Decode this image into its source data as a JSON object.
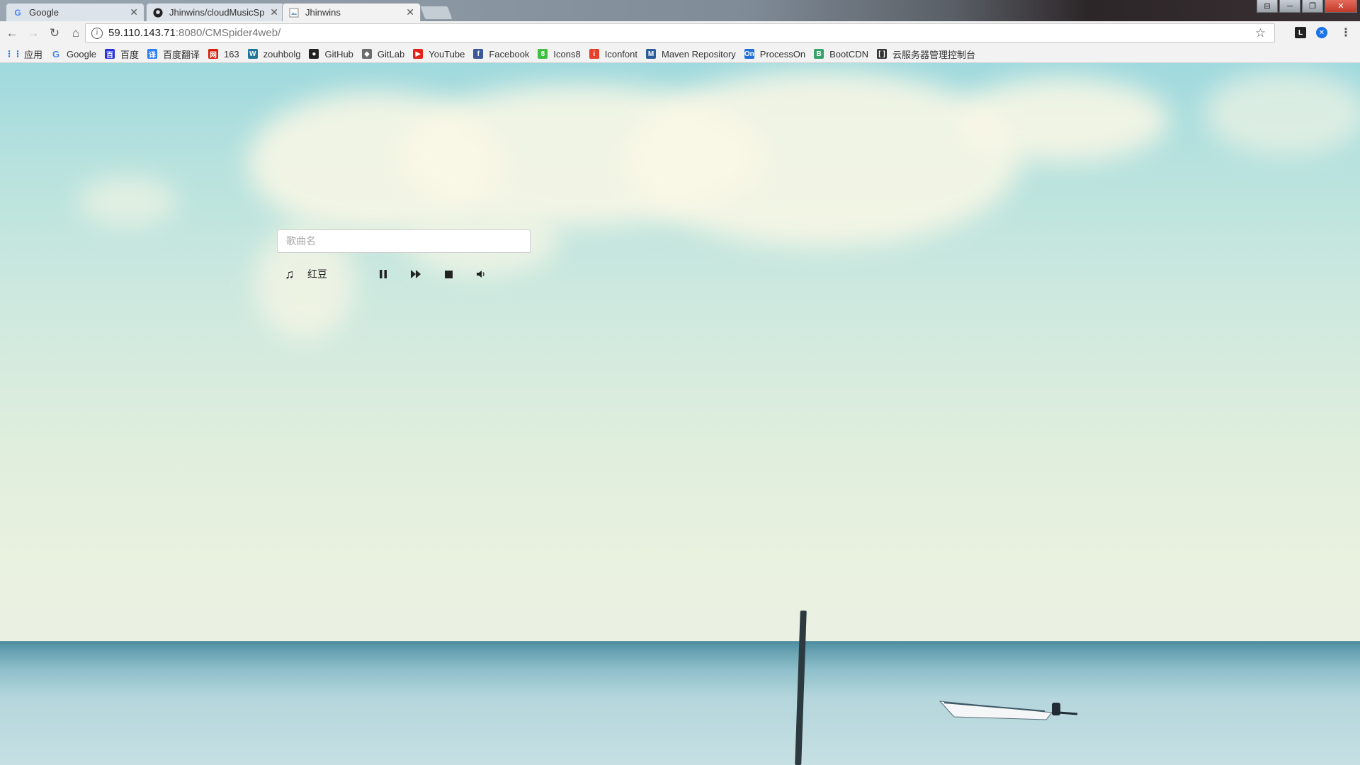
{
  "browser": {
    "tabs": [
      {
        "title": "Google",
        "icon": "google-icon"
      },
      {
        "title": "Jhinwins/cloudMusicSp",
        "icon": "github-icon"
      },
      {
        "title": "Jhinwins",
        "icon": "page-icon"
      }
    ],
    "url_host": "59.110.143.71",
    "url_path": ":8080/CMSpider4web/"
  },
  "bookmarks": [
    {
      "label": "应用",
      "icon": "apps-grid-icon",
      "color": "#1a73e8"
    },
    {
      "label": "Google",
      "icon": "google-icon",
      "color": "#4285f4"
    },
    {
      "label": "百度",
      "icon": "baidu-icon",
      "color": "#2932e1"
    },
    {
      "label": "百度翻译",
      "icon": "baidu-translate-icon",
      "color": "#2f7df6"
    },
    {
      "label": "163",
      "icon": "netease-icon",
      "color": "#d81e06"
    },
    {
      "label": "zouhbolg",
      "icon": "wordpress-icon",
      "color": "#21759b"
    },
    {
      "label": "GitHub",
      "icon": "github-icon",
      "color": "#222222"
    },
    {
      "label": "GitLab",
      "icon": "gitlab-icon",
      "color": "#6b6b6b"
    },
    {
      "label": "YouTube",
      "icon": "youtube-icon",
      "color": "#e62117"
    },
    {
      "label": "Facebook",
      "icon": "facebook-icon",
      "color": "#3b5998"
    },
    {
      "label": "Icons8",
      "icon": "icons8-icon",
      "color": "#3fbf3f"
    },
    {
      "label": "Iconfont",
      "icon": "iconfont-icon",
      "color": "#e5412a"
    },
    {
      "label": "Maven Repository",
      "icon": "maven-icon",
      "color": "#2c5d9a"
    },
    {
      "label": "ProcessOn",
      "icon": "processon-icon",
      "color": "#1e6fd9"
    },
    {
      "label": "BootCDN",
      "icon": "bootcdn-icon",
      "color": "#3aa36b"
    },
    {
      "label": "云服务器管理控制台",
      "icon": "aliyun-icon",
      "color": "#333333"
    }
  ],
  "player": {
    "search_placeholder": "歌曲名",
    "search_value": "",
    "current_song": "红豆"
  }
}
